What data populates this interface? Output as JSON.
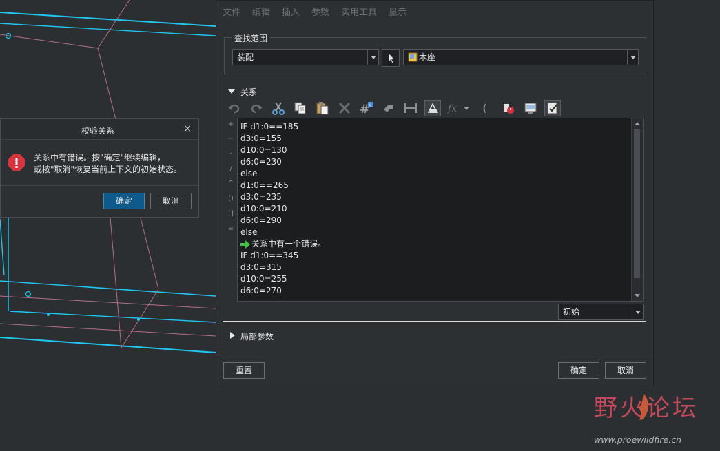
{
  "menubar": {
    "items": [
      "文件",
      "编辑",
      "插入",
      "参数",
      "实用工具",
      "显示"
    ]
  },
  "find_scope": {
    "title": "查找范围",
    "type_value": "装配",
    "model_value": "木座"
  },
  "relations": {
    "title": "关系",
    "lines": [
      "IF d1:0==185",
      "d3:0=155",
      "d10:0=130",
      "d6:0=230",
      "else",
      "d1:0==265",
      "d3:0=235",
      "d10:0=210",
      "d6:0=290",
      "else",
      "关系中有一个错误。",
      "IF d1:0==345",
      "d3:0=315",
      "d10:0=255",
      "d6:0=270"
    ],
    "units_value": "初始"
  },
  "local_params": {
    "title": "局部参数"
  },
  "footer": {
    "reset_label": "重置",
    "ok_label": "确定",
    "cancel_label": "取消"
  },
  "popup": {
    "title": "校验关系",
    "close_glyph": "×",
    "message_line1": "关系中有错误。按\"确定\"继续编辑，",
    "message_line2": "或按\"取消\"恢复当前上下文的初始状态。",
    "ok_label": "确定",
    "cancel_label": "取消"
  },
  "watermark": {
    "text": "野火论坛",
    "url": "www.proewildfire.cn"
  },
  "colors": {
    "accent": "#0e5a8a",
    "error": "#d9343e",
    "cad_edge": "#1ec8f0",
    "cad_line": "#b56f84"
  }
}
